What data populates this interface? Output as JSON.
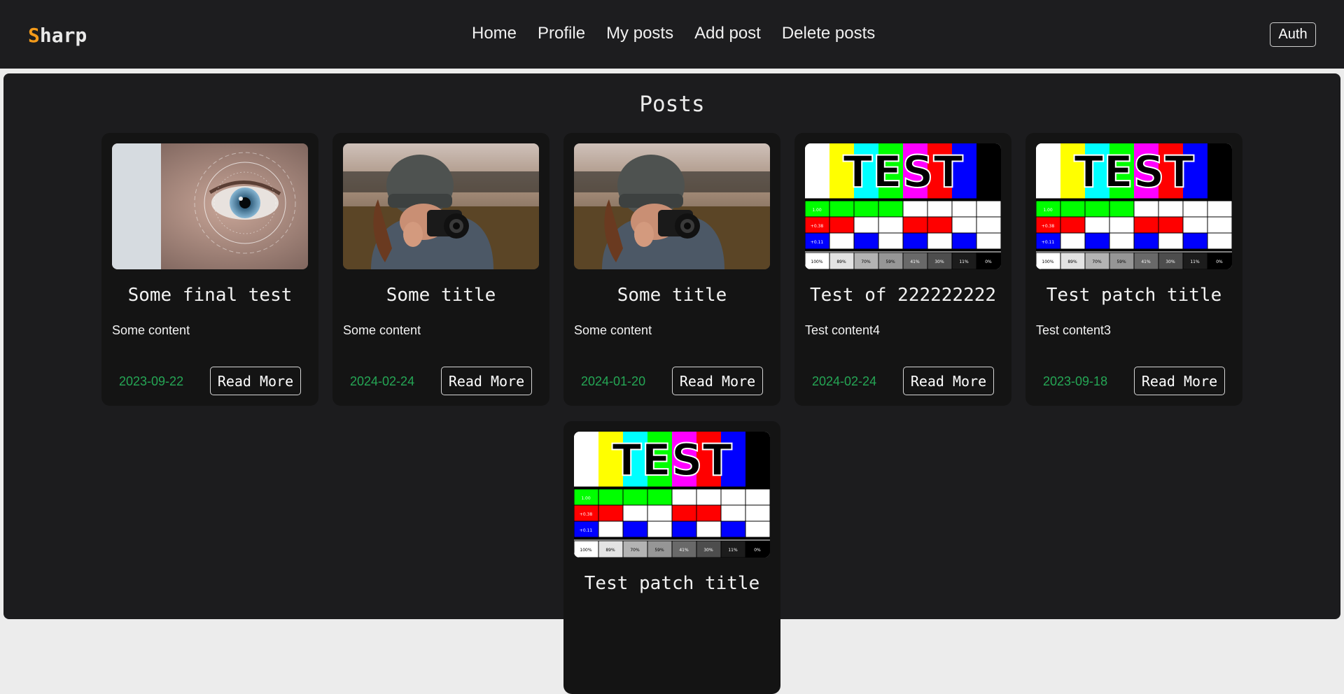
{
  "nav": {
    "brand_first": "S",
    "brand_rest": "harp",
    "links": [
      "Home",
      "Profile",
      "My posts",
      "Add post",
      "Delete posts"
    ],
    "auth_label": "Auth"
  },
  "main": {
    "heading": "Posts"
  },
  "posts": [
    {
      "title": "Some final test",
      "content": "Some content",
      "date": "2023-09-22",
      "read_more": "Read More",
      "image": "eye-scan"
    },
    {
      "title": "Some title",
      "content": "Some content",
      "date": "2024-02-24",
      "read_more": "Read More",
      "image": "photographer"
    },
    {
      "title": "Some title",
      "content": "Some content",
      "date": "2024-01-20",
      "read_more": "Read More",
      "image": "photographer"
    },
    {
      "title": "Test of 222222222",
      "content": "Test content4",
      "date": "2024-02-24",
      "read_more": "Read More",
      "image": "test-pattern"
    },
    {
      "title": "Test patch title",
      "content": "Test content3",
      "date": "2023-09-18",
      "read_more": "Read More",
      "image": "test-pattern"
    },
    {
      "title": "Test patch title",
      "image": "test-pattern"
    }
  ],
  "test_pattern": {
    "label": "TEST",
    "gamma_labels": [
      "1.00",
      "+0.38",
      "+0.11"
    ],
    "gray_labels": [
      "100%",
      "89%",
      "70%",
      "59%",
      "41%",
      "30%",
      "11%",
      "0%"
    ]
  },
  "colors": {
    "accent": "#f39a1a",
    "date_green": "#25a655",
    "navbar_bg": "#1d1d1f",
    "card_bg": "#141414"
  }
}
